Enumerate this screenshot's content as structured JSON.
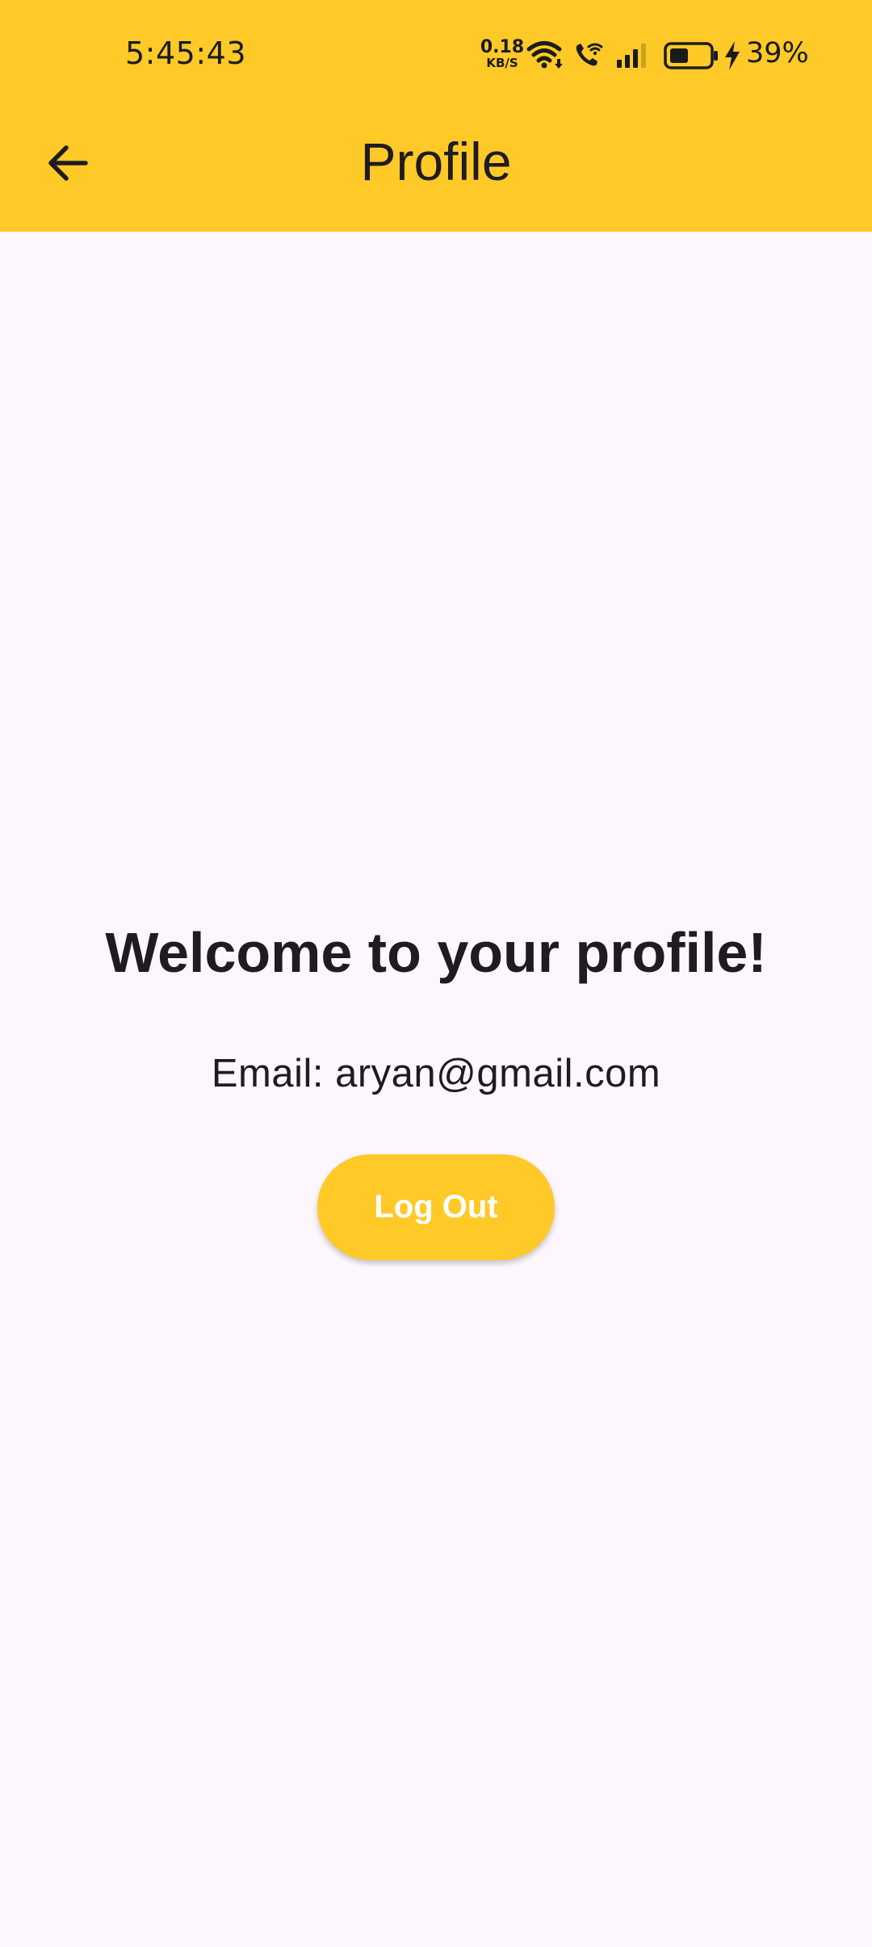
{
  "status_bar": {
    "time": "5:45:43",
    "net_speed_value": "0.18",
    "net_speed_unit": "KB/S",
    "battery_percent": "39%",
    "icons": [
      "wifi-icon",
      "wifi-calling-icon",
      "signal-icon",
      "battery-icon",
      "charging-bolt-icon"
    ]
  },
  "app_bar": {
    "title": "Profile",
    "back_icon": "arrow-back-icon"
  },
  "content": {
    "welcome": "Welcome to your profile!",
    "email": "Email: aryan@gmail.com",
    "logout_label": "Log Out"
  },
  "colors": {
    "accent": "#FFC928",
    "background": "#FDF7FD",
    "text": "#1F1B20",
    "button_text": "#FFFFFF"
  }
}
